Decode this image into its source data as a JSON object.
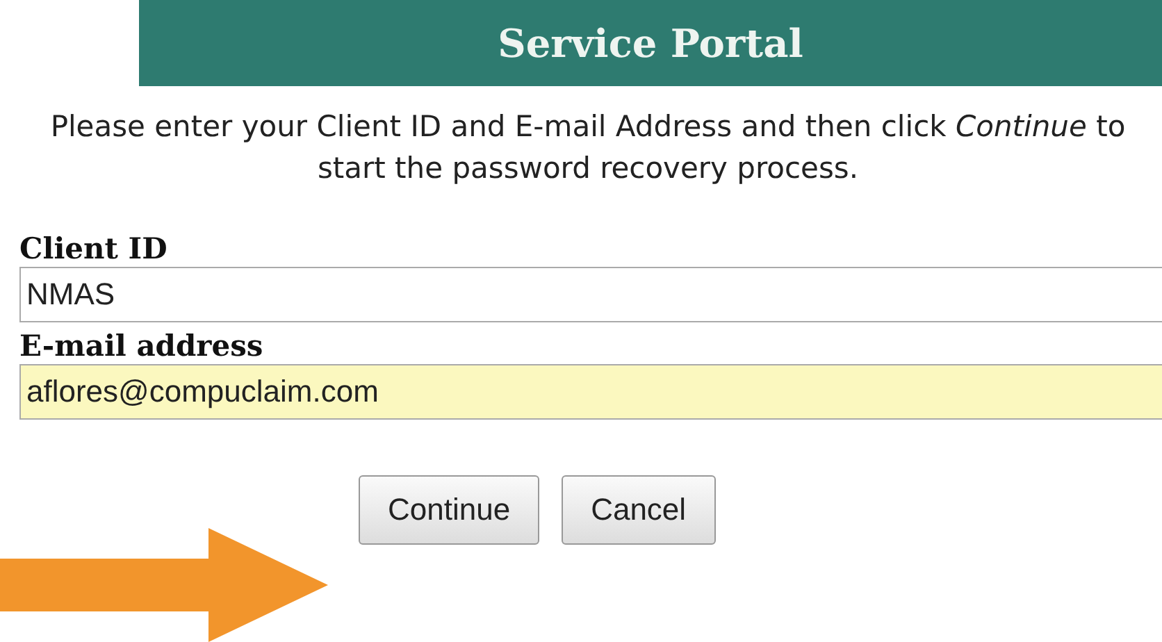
{
  "title": "Service Portal",
  "instructions": "Please enter your Client ID and E-mail Address and then click *Continue* to start the password recovery process.",
  "fields": [
    {
      "label": "Client ID",
      "value": "NMAS",
      "highlighted": false
    },
    {
      "label": "E-mail address",
      "value": "aflores@compuclaim.com",
      "highlighted": true
    }
  ],
  "buttons": [
    "Continue",
    "Cancel"
  ]
}
